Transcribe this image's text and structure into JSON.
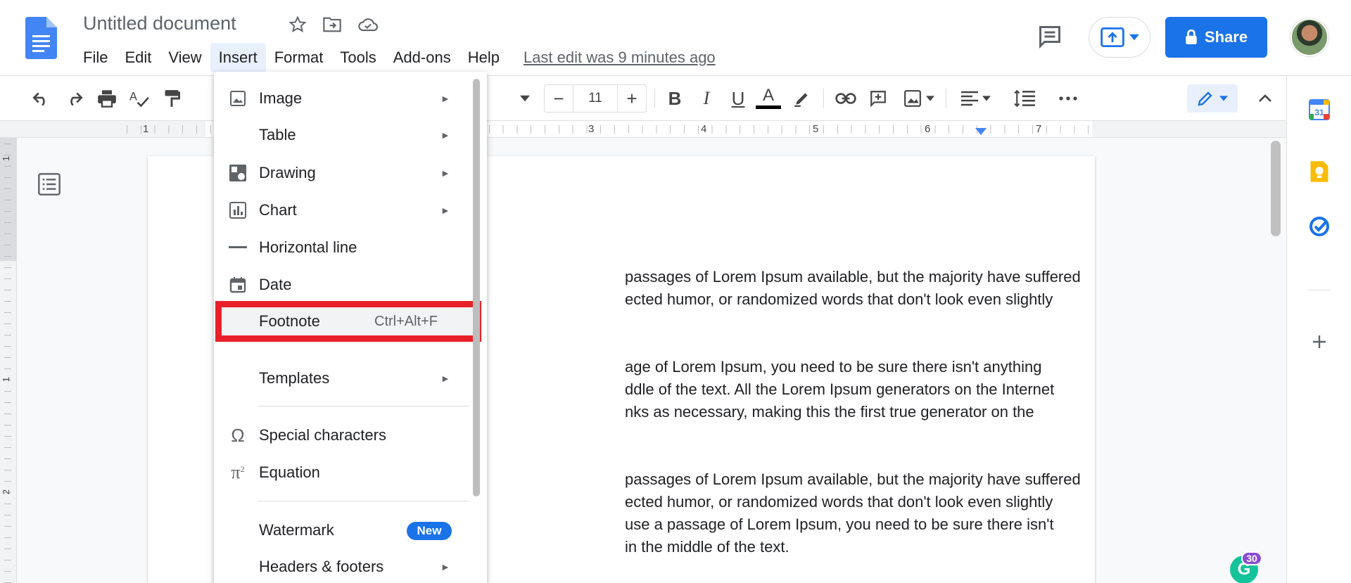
{
  "header": {
    "doc_title": "Untitled document",
    "last_edit": "Last edit was 9 minutes ago",
    "share_label": "Share"
  },
  "menubar": {
    "items": [
      "File",
      "Edit",
      "View",
      "Insert",
      "Format",
      "Tools",
      "Add-ons",
      "Help"
    ],
    "active": "Insert"
  },
  "toolbar": {
    "font_size": "11"
  },
  "ruler": {
    "numbers": [
      "1",
      "3",
      "4",
      "5",
      "6",
      "7"
    ]
  },
  "vruler": {
    "numbers": [
      "1",
      "1",
      "2"
    ]
  },
  "insert_menu": {
    "items": [
      {
        "label": "Image",
        "icon": "image-icon",
        "submenu": true
      },
      {
        "label": "Table",
        "icon": "",
        "submenu": true
      },
      {
        "label": "Drawing",
        "icon": "drawing-icon",
        "submenu": true
      },
      {
        "label": "Chart",
        "icon": "chart-icon",
        "submenu": true
      },
      {
        "label": "Horizontal line",
        "icon": "horizontal-line-icon",
        "submenu": false
      },
      {
        "label": "Date",
        "icon": "calendar-icon",
        "submenu": false
      },
      {
        "label": "Footnote",
        "shortcut": "Ctrl+Alt+F",
        "highlighted": true
      },
      {
        "label": "Templates",
        "submenu": true
      },
      {
        "label": "Special characters",
        "icon": "omega-icon",
        "submenu": false
      },
      {
        "label": "Equation",
        "icon": "pi-icon",
        "submenu": false
      },
      {
        "label": "Watermark",
        "badge": "New"
      },
      {
        "label": "Headers & footers",
        "submenu": true
      }
    ],
    "arrow_glyph": "►",
    "highlight_color": "#e8202a"
  },
  "document": {
    "paragraphs": [
      "passages of Lorem Ipsum available, but the majority have suffered",
      "ected humor, or randomized words that don't look even slightly",
      "age of Lorem Ipsum, you need to be sure there isn't anything",
      "ddle of the text. All the Lorem Ipsum generators on the Internet",
      "nks as necessary, making this the first true generator on the",
      "passages of Lorem Ipsum available, but the majority have suffered",
      "ected humor, or randomized words that don't look even slightly",
      "use a passage of Lorem Ipsum, you need to be sure there isn't",
      " in the middle of the text."
    ]
  },
  "grammarly": {
    "count": "30",
    "letter": "G"
  },
  "colors": {
    "accent": "#1a73e8",
    "docs_blue": "#4285f4",
    "highlight_red": "#e8202a"
  }
}
